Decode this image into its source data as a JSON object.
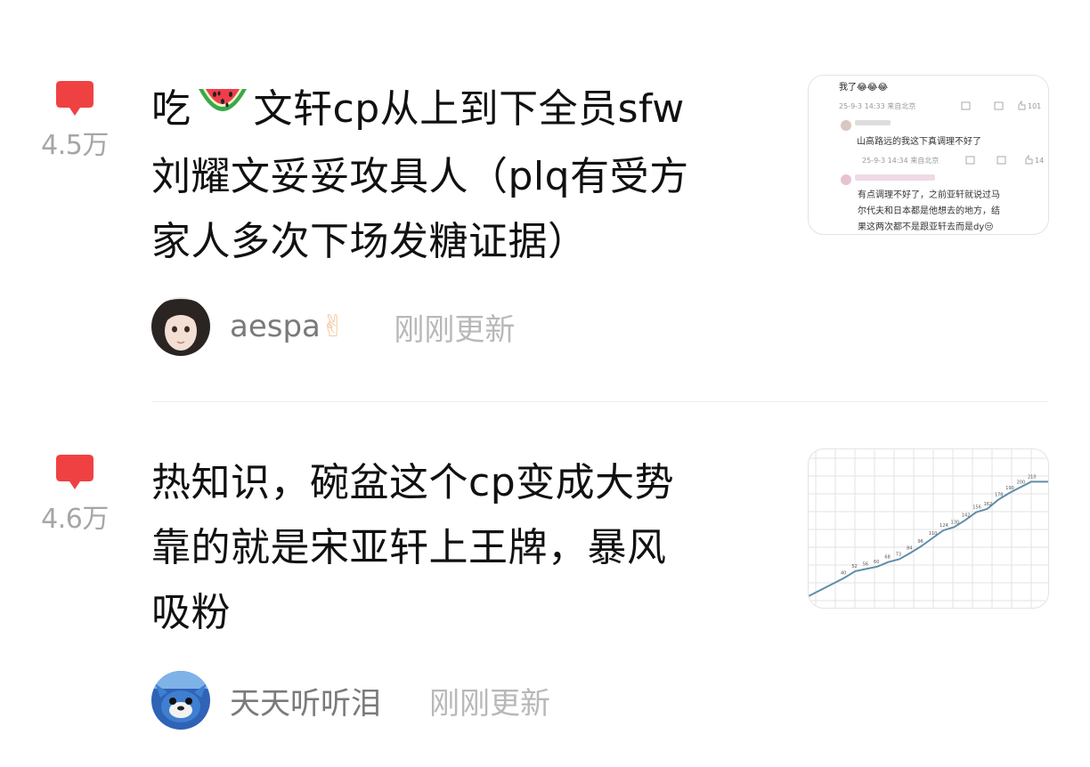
{
  "posts": [
    {
      "comment_count": "4.5万",
      "title": "吃🍉 文轩cp从上到下全员sfw刘耀文妥妥攻具人（plq有受方家人多次下场发糖证据）",
      "title_line1_a": "吃",
      "title_line1_b": "文轩cp从上到下全员sfw",
      "title_line2": "刘耀文妥妥攻具人（plq有受方",
      "title_line3": "家人多次下场发糖证据）",
      "author": "aespa✌️",
      "author_text": "aespa",
      "author_emoji": "✌",
      "time": "刚刚更新",
      "thumbnail": {
        "first_text": "我了😂😂😂",
        "comment1_meta": "25-9-3 14:33 来自北京",
        "comment1_text": "山高路远的我这下真调理不好了",
        "comment1_likes": "101",
        "comment2_meta": "25-9-3 14:34 来自北京",
        "comment2_likes": "14",
        "comment2_line1": "有点调理不好了，之前亚轩就说过马",
        "comment2_line2": "尔代夫和日本都是他想去的地方，结",
        "comment2_line3": "果这两次都不是跟亚轩去而是dy😒"
      }
    },
    {
      "comment_count": "4.6万",
      "title_line1": "热知识，碗盆这个cp变成大势",
      "title_line2": "靠的就是宋亚轩上王牌，暴风",
      "title_line3": "吸粉",
      "author": "天天听听泪",
      "time": "刚刚更新",
      "thumbnail": {
        "chart_data": {
          "type": "line",
          "point_labels": [
            "40",
            "52",
            "56",
            "60",
            "68",
            "73",
            "84",
            "96",
            "110",
            "124",
            "130",
            "142",
            "156",
            "162",
            "178",
            "190",
            "200",
            "210"
          ]
        }
      }
    }
  ],
  "colors": {
    "accent": "#f04142",
    "count": "#a6a6a6",
    "author": "#7a7a7a",
    "time": "#b8b8b8"
  }
}
